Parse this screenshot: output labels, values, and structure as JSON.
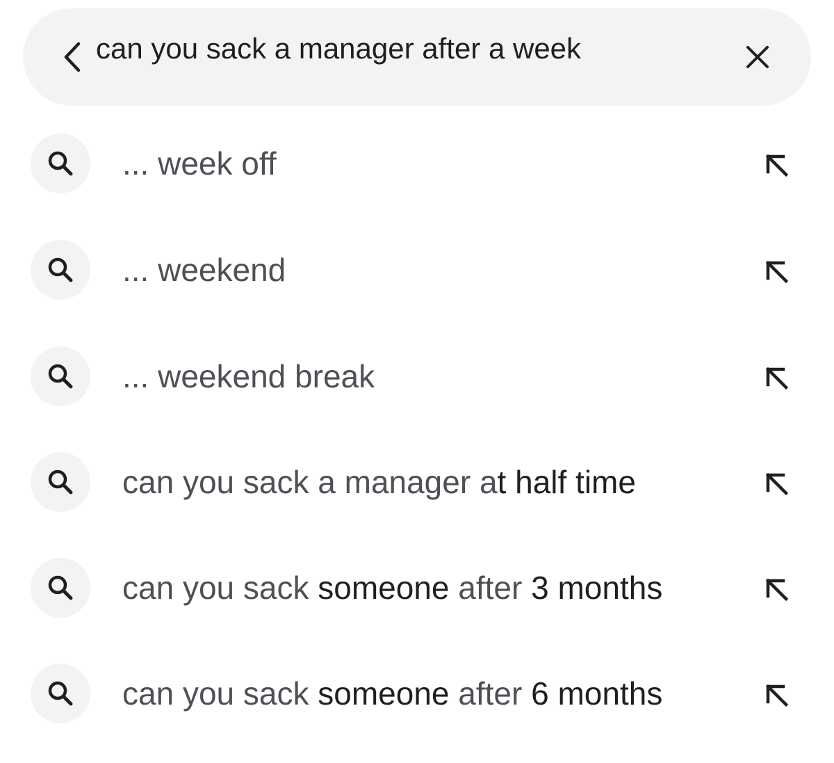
{
  "search": {
    "query": "can you sack a manager after a week",
    "back_icon": "chevron-left-icon",
    "clear_icon": "close-icon"
  },
  "suggestions": [
    {
      "parts": [
        {
          "text": "... week off",
          "bold": false
        }
      ]
    },
    {
      "parts": [
        {
          "text": "... weekend",
          "bold": false
        }
      ]
    },
    {
      "parts": [
        {
          "text": "... weekend break",
          "bold": false
        }
      ]
    },
    {
      "parts": [
        {
          "text": "can you sack a manager a",
          "bold": false
        },
        {
          "text": "t half time",
          "bold": true
        }
      ]
    },
    {
      "parts": [
        {
          "text": "can you sack ",
          "bold": false
        },
        {
          "text": "someone",
          "bold": true
        },
        {
          "text": " after ",
          "bold": false
        },
        {
          "text": "3 months",
          "bold": true
        }
      ]
    },
    {
      "parts": [
        {
          "text": "can you sack ",
          "bold": false
        },
        {
          "text": "someone",
          "bold": true
        },
        {
          "text": " after ",
          "bold": false
        },
        {
          "text": "6 months",
          "bold": true
        }
      ]
    }
  ],
  "icons": {
    "suggestion_icon": "search-icon",
    "fill_icon": "arrow-up-left-icon"
  },
  "colors": {
    "search_bar_bg": "#f2f3f5",
    "icon_circle_bg": "#f1f3f4",
    "caret": "#8ab4f8",
    "text_primary": "#1f1f1f",
    "text_secondary": "#4d5156"
  }
}
